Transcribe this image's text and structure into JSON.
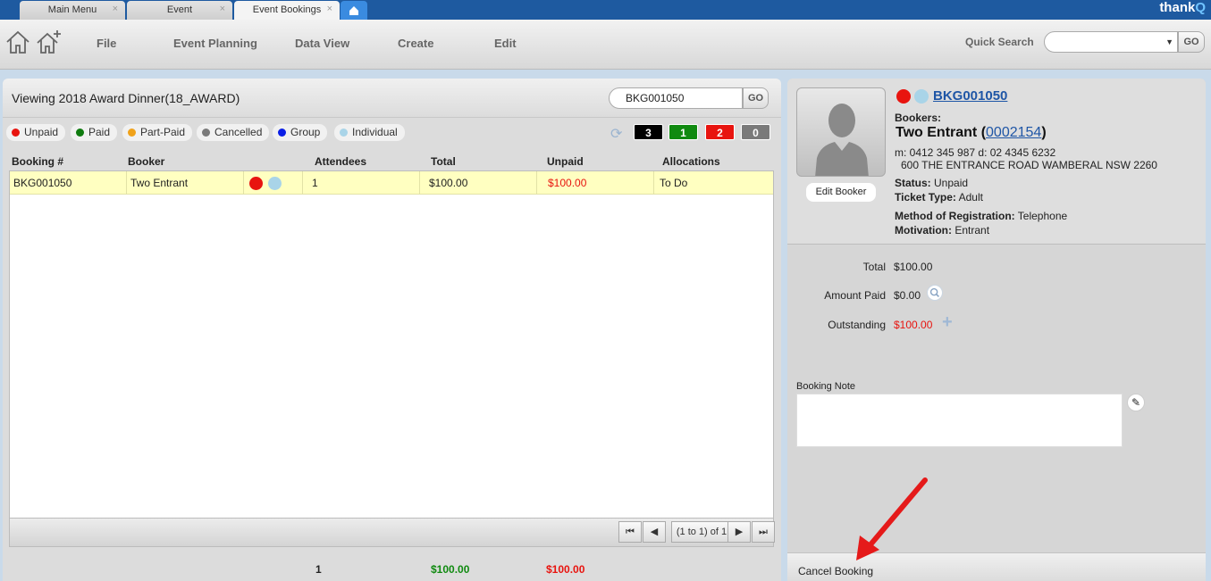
{
  "tabs": [
    {
      "label": "Main Menu",
      "close": "×"
    },
    {
      "label": "Event",
      "close": "×"
    },
    {
      "label": "Event Bookings",
      "close": "×"
    }
  ],
  "brand": {
    "text": "thank",
    "accent": "Q"
  },
  "menu": {
    "items": [
      "File",
      "Event Planning",
      "Data View",
      "Create",
      "Edit"
    ],
    "quick_search_label": "Quick Search",
    "quick_search_value": "",
    "go_label": "GO"
  },
  "left": {
    "title": "Viewing 2018 Award Dinner(18_AWARD)",
    "search_value": "BKG001050",
    "go_label": "GO",
    "legend": [
      {
        "label": "Unpaid",
        "color": "#e8140f"
      },
      {
        "label": "Paid",
        "color": "#0f7b0f"
      },
      {
        "label": "Part-Paid",
        "color": "#f0a21a"
      },
      {
        "label": "Cancelled",
        "color": "#7a7a7a"
      },
      {
        "label": "Group",
        "color": "#0a1ee6"
      },
      {
        "label": "Individual",
        "color": "#a9d4e8"
      }
    ],
    "counters": [
      {
        "value": "3",
        "color": "#000000"
      },
      {
        "value": "1",
        "color": "#108a10"
      },
      {
        "value": "2",
        "color": "#e8140f"
      },
      {
        "value": "0",
        "color": "#7a7a7a"
      }
    ],
    "columns": [
      "Booking #",
      "Booker",
      "Attendees",
      "Total",
      "Unpaid",
      "Allocations"
    ],
    "rows": [
      {
        "booking": "BKG001050",
        "booker": "Two Entrant",
        "attendees": "1",
        "total": "$100.00",
        "unpaid": "$100.00",
        "allocations": "To Do"
      }
    ],
    "pager": {
      "first": "⏮",
      "prev": "◀",
      "info": "(1 to 1) of 1",
      "next": "▶",
      "last": "⏭"
    },
    "totals": {
      "attendees": "1",
      "total": "$100.00",
      "unpaid": "$100.00"
    }
  },
  "right": {
    "booking_id": "BKG001050",
    "bookers_label": "Bookers:",
    "booker_name": "Two Entrant",
    "booker_id": "0002154",
    "contact": "m: 0412 345 987  d: 02 4345 6232",
    "address": "600 THE ENTRANCE ROAD  WAMBERAL NSW 2260",
    "status_label": "Status:",
    "status_value": "Unpaid",
    "ticket_label": "Ticket Type:",
    "ticket_value": "Adult",
    "method_label": "Method of Registration:",
    "method_value": "Telephone",
    "motivation_label": "Motivation:",
    "motivation_value": "Entrant",
    "edit_booker": "Edit Booker",
    "total_label": "Total",
    "total_value": "$100.00",
    "paid_label": "Amount Paid",
    "paid_value": "$0.00",
    "outstanding_label": "Outstanding",
    "outstanding_value": "$100.00",
    "note_label": "Booking Note",
    "note_value": "",
    "cancel_label": "Cancel Booking"
  }
}
